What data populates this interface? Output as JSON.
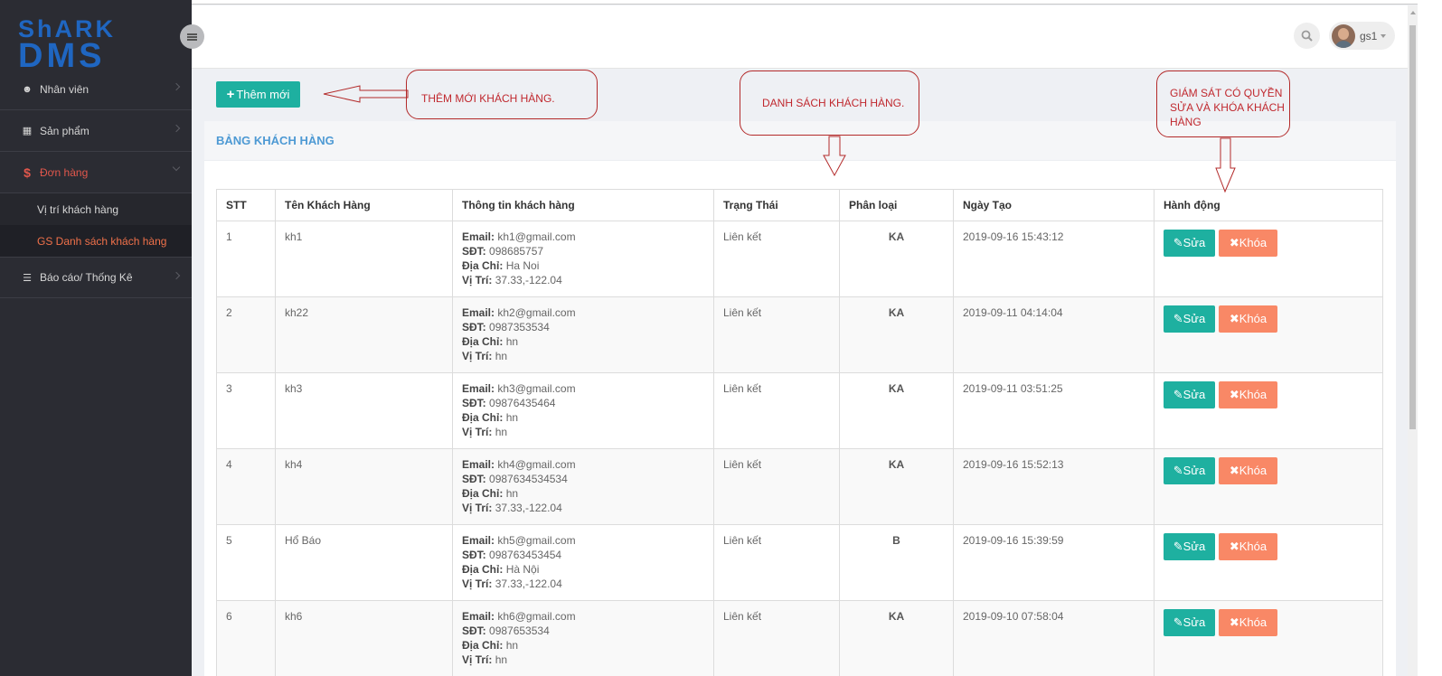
{
  "app": {
    "logo_line1": "ShARK",
    "logo_line2": "DMS"
  },
  "sidebar": {
    "items": [
      {
        "label": "Nhân viên",
        "icon": "users-icon"
      },
      {
        "label": "Sản phẩm",
        "icon": "gift-icon"
      },
      {
        "label": "Đơn hàng",
        "icon": "dollar-icon",
        "active": true
      },
      {
        "label": "Báo cáo/ Thống Kê",
        "icon": "list-icon"
      }
    ],
    "submenu": [
      {
        "label": "Vị trí khách hàng"
      },
      {
        "label": "GS Danh sách khách hàng",
        "selected": true
      }
    ]
  },
  "header": {
    "user_name": "gs1"
  },
  "toolbar": {
    "add_label": "Thêm mới"
  },
  "panel": {
    "title": "BẢNG KHÁCH HÀNG"
  },
  "table": {
    "columns": [
      "STT",
      "Tên Khách Hàng",
      "Thông tin khách hàng",
      "Trạng Thái",
      "Phân loại",
      "Ngày Tạo",
      "Hành động"
    ],
    "field_labels": {
      "email": "Email:",
      "phone": "SĐT:",
      "address": "Địa Chỉ:",
      "location": "Vị Trí:"
    },
    "edit_label": "Sửa",
    "lock_label": "Khóa",
    "rows": [
      {
        "stt": "1",
        "name": "kh1",
        "email": "kh1@gmail.com",
        "phone": "098685757",
        "address": "Ha Noi",
        "location": "37.33,-122.04",
        "status": "Liên kết",
        "type": "KA",
        "created": "2019-09-16 15:43:12"
      },
      {
        "stt": "2",
        "name": "kh22",
        "email": "kh2@gmail.com",
        "phone": "0987353534",
        "address": "hn",
        "location": "hn",
        "status": "Liên kết",
        "type": "KA",
        "created": "2019-09-11 04:14:04"
      },
      {
        "stt": "3",
        "name": "kh3",
        "email": "kh3@gmail.com",
        "phone": "09876435464",
        "address": "hn",
        "location": "hn",
        "status": "Liên kết",
        "type": "KA",
        "created": "2019-09-11 03:51:25"
      },
      {
        "stt": "4",
        "name": "kh4",
        "email": "kh4@gmail.com",
        "phone": "0987634534534",
        "address": "hn",
        "location": "37.33,-122.04",
        "status": "Liên kết",
        "type": "KA",
        "created": "2019-09-16 15:52:13"
      },
      {
        "stt": "5",
        "name": "Hổ Báo",
        "email": "kh5@gmail.com",
        "phone": "098763453454",
        "address": "Hà Nội",
        "location": "37.33,-122.04",
        "status": "Liên kết",
        "type": "B",
        "created": "2019-09-16 15:39:59"
      },
      {
        "stt": "6",
        "name": "kh6",
        "email": "kh6@gmail.com",
        "phone": "0987653534",
        "address": "hn",
        "location": "hn",
        "status": "Liên kết",
        "type": "KA",
        "created": "2019-09-10 07:58:04"
      }
    ]
  },
  "annotations": {
    "add_note": "THÊM MỚI KHÁCH HÀNG.",
    "list_note": "DANH SÁCH KHÁCH HÀNG.",
    "perm_note": "GIÁM SÁT CÓ QUYỀN SỬA VÀ KHÓA KHÁCH HÀNG"
  }
}
